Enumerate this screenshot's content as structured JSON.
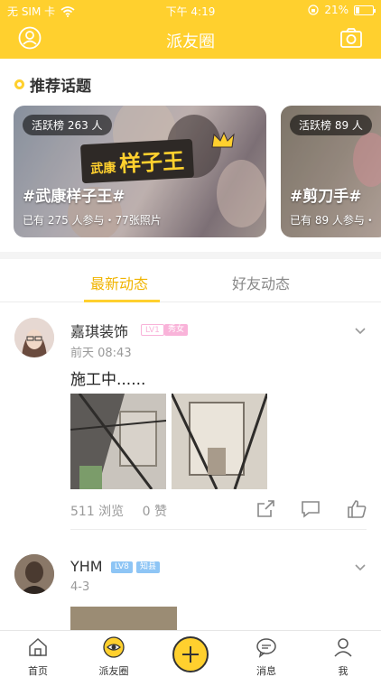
{
  "status_bar": {
    "carrier": "无 SIM 卡",
    "time": "下午 4:19",
    "battery": "21%"
  },
  "header": {
    "title": "派友圈",
    "left_icon": "profile-icon",
    "right_icon": "camera-icon"
  },
  "recommended": {
    "title": "推荐话题",
    "cards": [
      {
        "badge": "活跃榜 263 人",
        "banner_small": "武康",
        "banner_big": "样子王",
        "title": "#武康样子王#",
        "meta": "已有 275 人参与・77张照片"
      },
      {
        "badge": "活跃榜 89 人",
        "title": "#剪刀手#",
        "meta": "已有 89 人参与・"
      }
    ]
  },
  "tabs": [
    {
      "label": "最新动态",
      "active": true
    },
    {
      "label": "好友动态",
      "active": false
    }
  ],
  "posts": [
    {
      "user": "嘉琪装饰",
      "level": "LV1",
      "title_tag": "秀女",
      "time": "前天 08:43",
      "text": "施工中......",
      "views": "511 浏览",
      "likes": "0 赞"
    },
    {
      "user": "YHM",
      "level": "LV8",
      "title_tag": "知县",
      "time": "4-3"
    }
  ],
  "bottom_nav": [
    {
      "label": "首页",
      "icon": "home-icon"
    },
    {
      "label": "派友圈",
      "icon": "eye-icon",
      "active": true
    },
    {
      "label": "",
      "icon": "plus-icon"
    },
    {
      "label": "消息",
      "icon": "message-icon"
    },
    {
      "label": "我",
      "icon": "user-icon"
    }
  ],
  "colors": {
    "accent": "#ffd02e",
    "active_tab": "#f0b400",
    "level_tag_pink": "#f9b3d9",
    "level_tag_blue": "#8ec5f5"
  }
}
